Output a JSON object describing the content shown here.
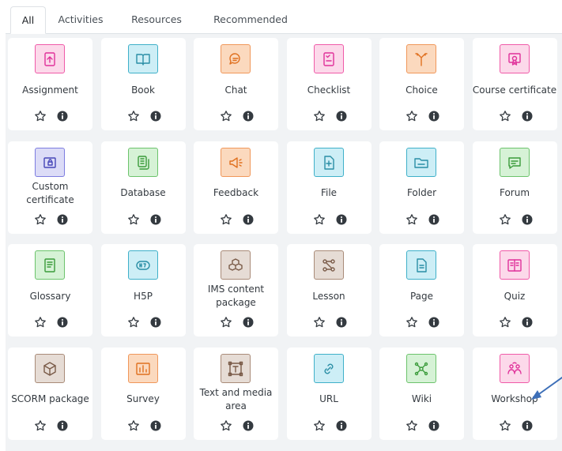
{
  "tabs": [
    {
      "label": "All",
      "active": true
    },
    {
      "label": "Activities",
      "active": false
    },
    {
      "label": "Resources",
      "active": false
    },
    {
      "label": "Recommended",
      "active": false
    }
  ],
  "colors": {
    "communication": "#f7634d",
    "pink": {
      "bg": "#fcd9ea",
      "border": "#f05aa8",
      "icon": "#e0319a"
    },
    "blue": {
      "bg": "#cdeef6",
      "border": "#3fb0c9",
      "icon": "#2a8ea5"
    },
    "orange": {
      "bg": "#fbd9be",
      "border": "#f0975a",
      "icon": "#e0701f"
    },
    "green": {
      "bg": "#d6f2d6",
      "border": "#6cc36c",
      "icon": "#3a9b3a"
    },
    "brown": {
      "bg": "#e6dcd5",
      "border": "#a98b78",
      "icon": "#7a5b48"
    },
    "purple": {
      "bg": "#dcdcf7",
      "border": "#7c7ce0",
      "icon": "#4646b8"
    },
    "arrow": "#3d6fb8"
  },
  "modules": [
    {
      "name": "Assignment",
      "icon": "assignment-icon",
      "color": "pink"
    },
    {
      "name": "Book",
      "icon": "book-icon",
      "color": "blue"
    },
    {
      "name": "Chat",
      "icon": "chat-icon",
      "color": "orange"
    },
    {
      "name": "Checklist",
      "icon": "checklist-icon",
      "color": "pink"
    },
    {
      "name": "Choice",
      "icon": "choice-icon",
      "color": "orange"
    },
    {
      "name": "Course certificate",
      "icon": "course-certificate-icon",
      "color": "pink"
    },
    {
      "name": "Custom certificate",
      "icon": "custom-certificate-icon",
      "color": "purple"
    },
    {
      "name": "Database",
      "icon": "database-icon",
      "color": "green"
    },
    {
      "name": "Feedback",
      "icon": "feedback-icon",
      "color": "orange"
    },
    {
      "name": "File",
      "icon": "file-icon",
      "color": "blue"
    },
    {
      "name": "Folder",
      "icon": "folder-icon",
      "color": "blue"
    },
    {
      "name": "Forum",
      "icon": "forum-icon",
      "color": "green"
    },
    {
      "name": "Glossary",
      "icon": "glossary-icon",
      "color": "green"
    },
    {
      "name": "H5P",
      "icon": "h5p-icon",
      "color": "blue"
    },
    {
      "name": "IMS content package",
      "icon": "ims-package-icon",
      "color": "brown"
    },
    {
      "name": "Lesson",
      "icon": "lesson-icon",
      "color": "brown"
    },
    {
      "name": "Page",
      "icon": "page-icon",
      "color": "blue"
    },
    {
      "name": "Quiz",
      "icon": "quiz-icon",
      "color": "pink"
    },
    {
      "name": "SCORM package",
      "icon": "scorm-package-icon",
      "color": "brown"
    },
    {
      "name": "Survey",
      "icon": "survey-icon",
      "color": "orange"
    },
    {
      "name": "Text and media area",
      "icon": "text-media-icon",
      "color": "brown"
    },
    {
      "name": "URL",
      "icon": "url-icon",
      "color": "blue"
    },
    {
      "name": "Wiki",
      "icon": "wiki-icon",
      "color": "green"
    },
    {
      "name": "Workshop",
      "icon": "workshop-icon",
      "color": "pink"
    }
  ]
}
